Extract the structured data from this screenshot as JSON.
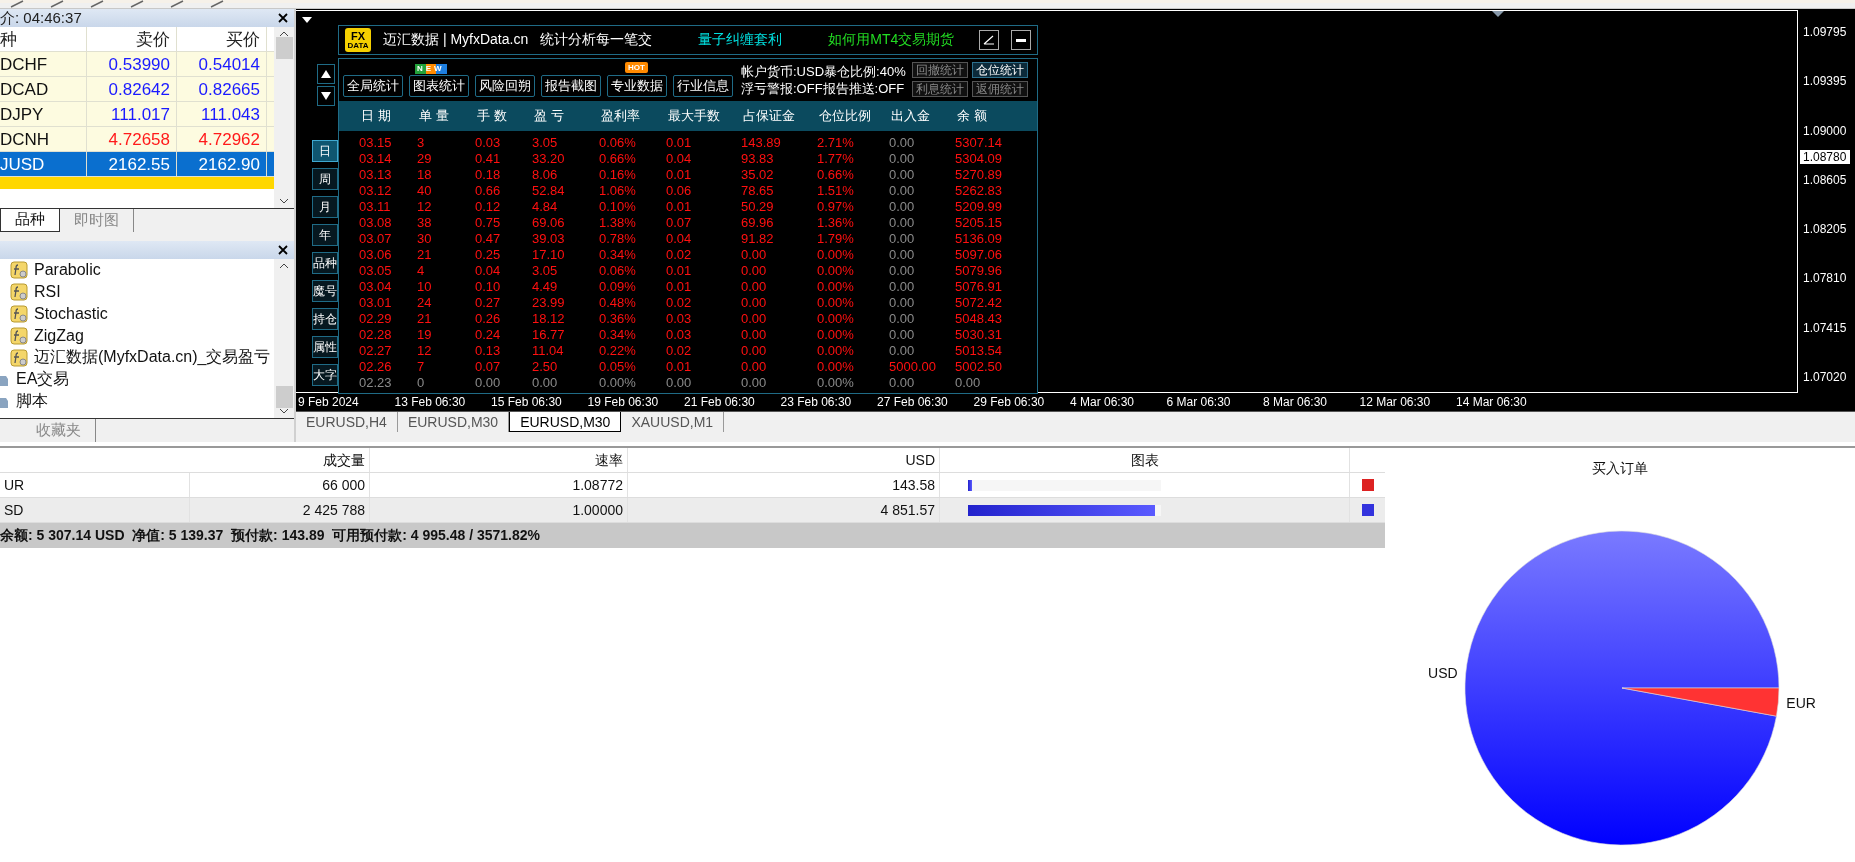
{
  "market_watch": {
    "title": "介: 04:46:37",
    "columns": [
      "种",
      "卖价",
      "买价"
    ],
    "rows": [
      {
        "symbol": "DCHF",
        "bid": "0.53990",
        "ask": "0.54014",
        "color": "#1a1aff",
        "selected": false
      },
      {
        "symbol": "DCAD",
        "bid": "0.82642",
        "ask": "0.82665",
        "color": "#1a1aff",
        "selected": false
      },
      {
        "symbol": "DJPY",
        "bid": "111.017",
        "ask": "111.043",
        "color": "#1a1aff",
        "selected": false
      },
      {
        "symbol": "DCNH",
        "bid": "4.72658",
        "ask": "4.72962",
        "color": "#ff1a1a",
        "selected": false
      },
      {
        "symbol": "JUSD",
        "bid": "2162.55",
        "ask": "2162.90",
        "selected": true
      }
    ],
    "tabs": [
      {
        "label": "品种",
        "selected": true
      },
      {
        "label": "即时图",
        "selected": false
      }
    ]
  },
  "navigator": {
    "items": [
      {
        "label": "Parabolic",
        "kind": "indicator"
      },
      {
        "label": "RSI",
        "kind": "indicator"
      },
      {
        "label": "Stochastic",
        "kind": "indicator"
      },
      {
        "label": "ZigZag",
        "kind": "indicator"
      },
      {
        "label": "迈汇数据(MyfxData.cn)_交易盈亏",
        "kind": "indicator"
      },
      {
        "label": "EA交易",
        "kind": "folder"
      },
      {
        "label": "脚本",
        "kind": "folder"
      }
    ],
    "tabs": [
      {
        "label": "收藏夹",
        "selected": false
      }
    ]
  },
  "chart": {
    "price_labels": [
      "1.09795",
      "1.09395",
      "1.09000",
      "1.08605",
      "1.08205",
      "1.07810",
      "1.07415",
      "1.07020"
    ],
    "current_price": "1.08780",
    "time_labels": [
      "9 Feb 2024",
      "13 Feb 06:30",
      "15 Feb 06:30",
      "19 Feb 06:30",
      "21 Feb 06:30",
      "23 Feb 06:30",
      "27 Feb 06:30",
      "29 Feb 06:30",
      "4 Mar 06:30",
      "6 Mar 06:30",
      "8 Mar 06:30",
      "12 Mar 06:30",
      "14 Mar 06:30"
    ],
    "tabs": [
      {
        "label": "EURUSD,H4",
        "selected": false
      },
      {
        "label": "EURUSD,M30",
        "selected": false
      },
      {
        "label": "EURUSD,M30",
        "selected": true
      },
      {
        "label": "XAUUSD,M1",
        "selected": false
      }
    ]
  },
  "stats_panel": {
    "logo": {
      "top": "FX",
      "bottom": "DATA"
    },
    "brand": "迈汇数据 | MyfxData.cn",
    "tagline": "统计分析每一笔交",
    "links": [
      {
        "label": "量子纠缠套利",
        "color": "#00e0e0"
      },
      {
        "label": "如何用MT4交易期货",
        "color": "#22dd22"
      }
    ],
    "buttons": [
      {
        "label": "全局统计"
      },
      {
        "label": "图表统计",
        "badge": {
          "kind": "new",
          "text": "NEW"
        }
      },
      {
        "label": "风险回朔"
      },
      {
        "label": "报告截图"
      },
      {
        "label": "专业数据",
        "badge": {
          "kind": "hot",
          "text": "HOT"
        }
      },
      {
        "label": "行业信息"
      }
    ],
    "info": [
      "帐户货币:USD暴仓比例:40%",
      "浮亏警报:OFF报告推送:OFF"
    ],
    "small_buttons": [
      {
        "label": "回撤统计",
        "disabled": true
      },
      {
        "label": "仓位统计",
        "disabled": false
      },
      {
        "label": "利息统计",
        "disabled": true
      },
      {
        "label": "返佣统计",
        "disabled": true
      }
    ],
    "side_tabs": [
      {
        "label": "日",
        "selected": true
      },
      {
        "label": "周",
        "selected": false
      },
      {
        "label": "月",
        "selected": false
      },
      {
        "label": "年",
        "selected": false
      },
      {
        "label": "品种",
        "selected": false
      },
      {
        "label": "魔号",
        "selected": false
      },
      {
        "label": "持仓",
        "selected": false
      },
      {
        "label": "属性",
        "selected": false
      },
      {
        "label": "大字",
        "selected": false
      }
    ],
    "columns": [
      "日 期",
      "单 量",
      "手 数",
      "盈 亏",
      "盈利率",
      "最大手数",
      "占保证金",
      "仓位比例",
      "出入金",
      "余 额"
    ],
    "rows": [
      {
        "kind": "trade",
        "cells": [
          "03.15",
          "3",
          "0.03",
          "3.05",
          "0.06%",
          "0.01",
          "143.89",
          "2.71%",
          "0.00",
          "5307.14"
        ]
      },
      {
        "kind": "trade",
        "cells": [
          "03.14",
          "29",
          "0.41",
          "33.20",
          "0.66%",
          "0.04",
          "93.83",
          "1.77%",
          "0.00",
          "5304.09"
        ]
      },
      {
        "kind": "trade",
        "cells": [
          "03.13",
          "18",
          "0.18",
          "8.06",
          "0.16%",
          "0.01",
          "35.02",
          "0.66%",
          "0.00",
          "5270.89"
        ]
      },
      {
        "kind": "trade",
        "cells": [
          "03.12",
          "40",
          "0.66",
          "52.84",
          "1.06%",
          "0.06",
          "78.65",
          "1.51%",
          "0.00",
          "5262.83"
        ]
      },
      {
        "kind": "trade",
        "cells": [
          "03.11",
          "12",
          "0.12",
          "4.84",
          "0.10%",
          "0.01",
          "50.29",
          "0.97%",
          "0.00",
          "5209.99"
        ]
      },
      {
        "kind": "trade",
        "cells": [
          "03.08",
          "38",
          "0.75",
          "69.06",
          "1.38%",
          "0.07",
          "69.96",
          "1.36%",
          "0.00",
          "5205.15"
        ]
      },
      {
        "kind": "trade",
        "cells": [
          "03.07",
          "30",
          "0.47",
          "39.03",
          "0.78%",
          "0.04",
          "91.82",
          "1.79%",
          "0.00",
          "5136.09"
        ]
      },
      {
        "kind": "trade",
        "cells": [
          "03.06",
          "21",
          "0.25",
          "17.10",
          "0.34%",
          "0.02",
          "0.00",
          "0.00%",
          "0.00",
          "5097.06"
        ]
      },
      {
        "kind": "trade",
        "cells": [
          "03.05",
          "4",
          "0.04",
          "3.05",
          "0.06%",
          "0.01",
          "0.00",
          "0.00%",
          "0.00",
          "5079.96"
        ]
      },
      {
        "kind": "trade",
        "cells": [
          "03.04",
          "10",
          "0.10",
          "4.49",
          "0.09%",
          "0.01",
          "0.00",
          "0.00%",
          "0.00",
          "5076.91"
        ]
      },
      {
        "kind": "trade",
        "cells": [
          "03.01",
          "24",
          "0.27",
          "23.99",
          "0.48%",
          "0.02",
          "0.00",
          "0.00%",
          "0.00",
          "5072.42"
        ]
      },
      {
        "kind": "trade",
        "cells": [
          "02.29",
          "21",
          "0.26",
          "18.12",
          "0.36%",
          "0.03",
          "0.00",
          "0.00%",
          "0.00",
          "5048.43"
        ]
      },
      {
        "kind": "trade",
        "cells": [
          "02.28",
          "19",
          "0.24",
          "16.77",
          "0.34%",
          "0.03",
          "0.00",
          "0.00%",
          "0.00",
          "5030.31"
        ]
      },
      {
        "kind": "trade",
        "cells": [
          "02.27",
          "12",
          "0.13",
          "11.04",
          "0.22%",
          "0.02",
          "0.00",
          "0.00%",
          "0.00",
          "5013.54"
        ]
      },
      {
        "kind": "deposit",
        "cells": [
          "02.26",
          "7",
          "0.07",
          "2.50",
          "0.05%",
          "0.01",
          "0.00",
          "0.00%",
          "5000.00",
          "5002.50"
        ]
      },
      {
        "kind": "none",
        "cells": [
          "02.23",
          "0",
          "0.00",
          "0.00",
          "0.00%",
          "0.00",
          "0.00",
          "0.00%",
          "0.00",
          "0.00"
        ]
      }
    ]
  },
  "exposure": {
    "columns": [
      "成交量",
      "速率",
      "USD",
      "图表"
    ],
    "rows": [
      {
        "asset": "UR",
        "volume": "66 000",
        "rate": "1.08772",
        "usd": "143.58",
        "level": 0.02,
        "color": "#dd2222"
      },
      {
        "asset": "SD",
        "volume": "2 425 788",
        "rate": "1.00000",
        "usd": "4 851.57",
        "level": 0.97,
        "color": "#3333dd"
      }
    ],
    "status": "余额: 5 307.14 USD  净值: 5 139.37  预付款: 143.89  可用预付款: 4 995.48 / 3571.82%"
  },
  "pie": {
    "chart_data": {
      "type": "pie",
      "title": "买入订单",
      "categories": [
        "USD",
        "EUR"
      ],
      "values": [
        97.13,
        2.87
      ]
    }
  }
}
